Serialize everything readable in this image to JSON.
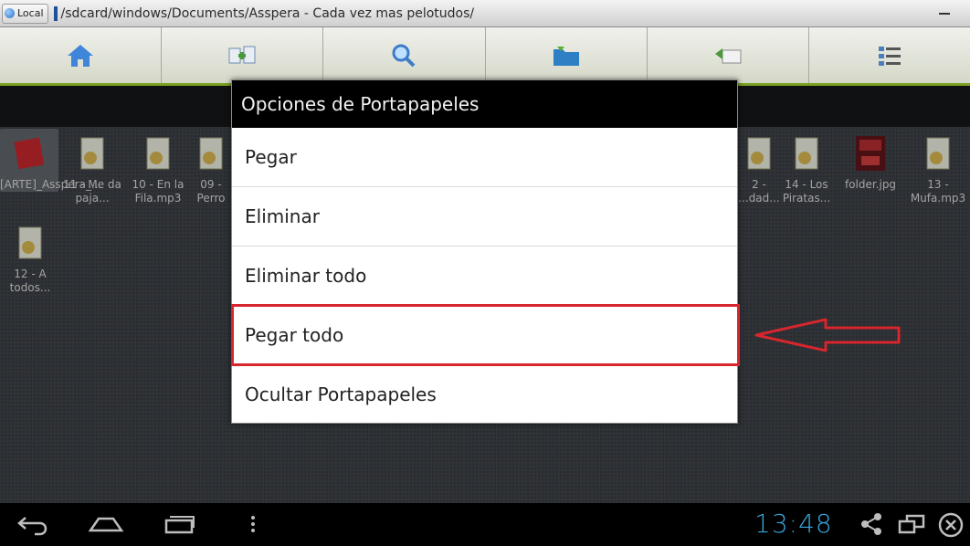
{
  "path_bar": {
    "local_label": "Local",
    "path": "/sdcard/windows/Documents/Asspera - Cada vez mas pelotudos/"
  },
  "toolbar": {
    "buttons": [
      "home-icon",
      "multi-select-icon",
      "search-icon",
      "folder-icon",
      "clipboard-back-icon",
      "list-view-icon"
    ]
  },
  "files": [
    {
      "name": "[ARTE]_Asspera_...",
      "icon": "image-file-icon",
      "selected": true
    },
    {
      "name": "11 - Me da paja...",
      "icon": "audio-file-icon"
    },
    {
      "name": "10 - En la Fila.mp3",
      "icon": "audio-file-icon"
    },
    {
      "name": "09 - Perro",
      "icon": "audio-file-icon"
    },
    {
      "name": "2 - ...dad...",
      "icon": "audio-file-icon"
    },
    {
      "name": "14 - Los Piratas...",
      "icon": "audio-file-icon"
    },
    {
      "name": "folder.jpg",
      "icon": "image-file-icon"
    },
    {
      "name": "13 - Mufa.mp3",
      "icon": "audio-file-icon"
    },
    {
      "name": "12 - A todos...",
      "icon": "audio-file-icon"
    }
  ],
  "dialog": {
    "title": "Opciones de Portapapeles",
    "options": [
      "Pegar",
      "Eliminar",
      "Eliminar todo",
      "Pegar todo",
      "Ocultar Portapapeles"
    ],
    "highlighted_option": "Pegar todo",
    "highlight_color": "#d8262e"
  },
  "navbar": {
    "clock": "13:48",
    "clock_color": "#36a7d9",
    "icons": [
      "back-icon",
      "home-icon",
      "recent-apps-icon",
      "menu-dots-icon",
      "share-icon",
      "window-icon",
      "close-icon"
    ]
  }
}
